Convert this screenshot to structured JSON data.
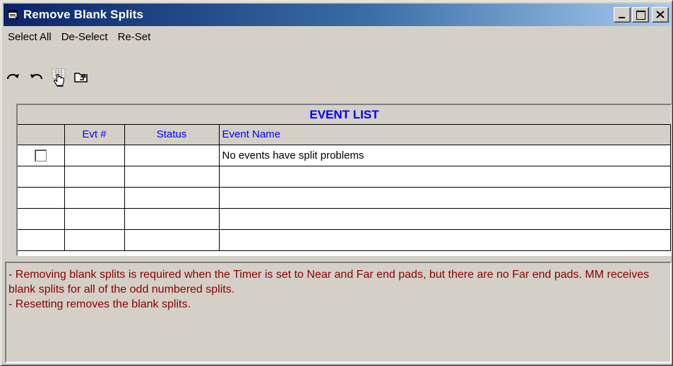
{
  "window": {
    "title": "Remove Blank Splits",
    "title_icon": "window-icon",
    "controls": [
      "minimize-icon",
      "maximize-icon",
      "close-icon"
    ]
  },
  "menu": {
    "items": [
      {
        "label": "Select All"
      },
      {
        "label": "De-Select"
      },
      {
        "label": "Re-Set"
      }
    ]
  },
  "toolbar": {
    "tools": [
      {
        "icon": "redo-icon"
      },
      {
        "icon": "undo-icon"
      },
      {
        "icon": "select-grid-hand-icon"
      },
      {
        "icon": "up-folder-icon"
      }
    ]
  },
  "grid": {
    "title": "EVENT LIST",
    "columns": [
      "",
      "Evt #",
      "Status",
      "Event Name"
    ],
    "rows": [
      {
        "checked": false,
        "evt": "",
        "status": "",
        "name": "No events have split problems"
      },
      {
        "evt": "",
        "status": "",
        "name": ""
      },
      {
        "evt": "",
        "status": "",
        "name": ""
      },
      {
        "evt": "",
        "status": "",
        "name": ""
      },
      {
        "evt": "",
        "status": "",
        "name": ""
      }
    ]
  },
  "info": {
    "line1": " - Removing blank splits is required when the Timer is set to Near and Far end pads, but there are no Far end pads. MM receives blank splits for all of the odd numbered splits.",
    "line2": " - Resetting removes the blank splits."
  },
  "colors": {
    "title_gradient_start": "#0a246a",
    "title_gradient_end": "#a6caf0",
    "face": "#d4d0c8",
    "header_text": "#0000ff",
    "info_text": "#8b0000"
  }
}
